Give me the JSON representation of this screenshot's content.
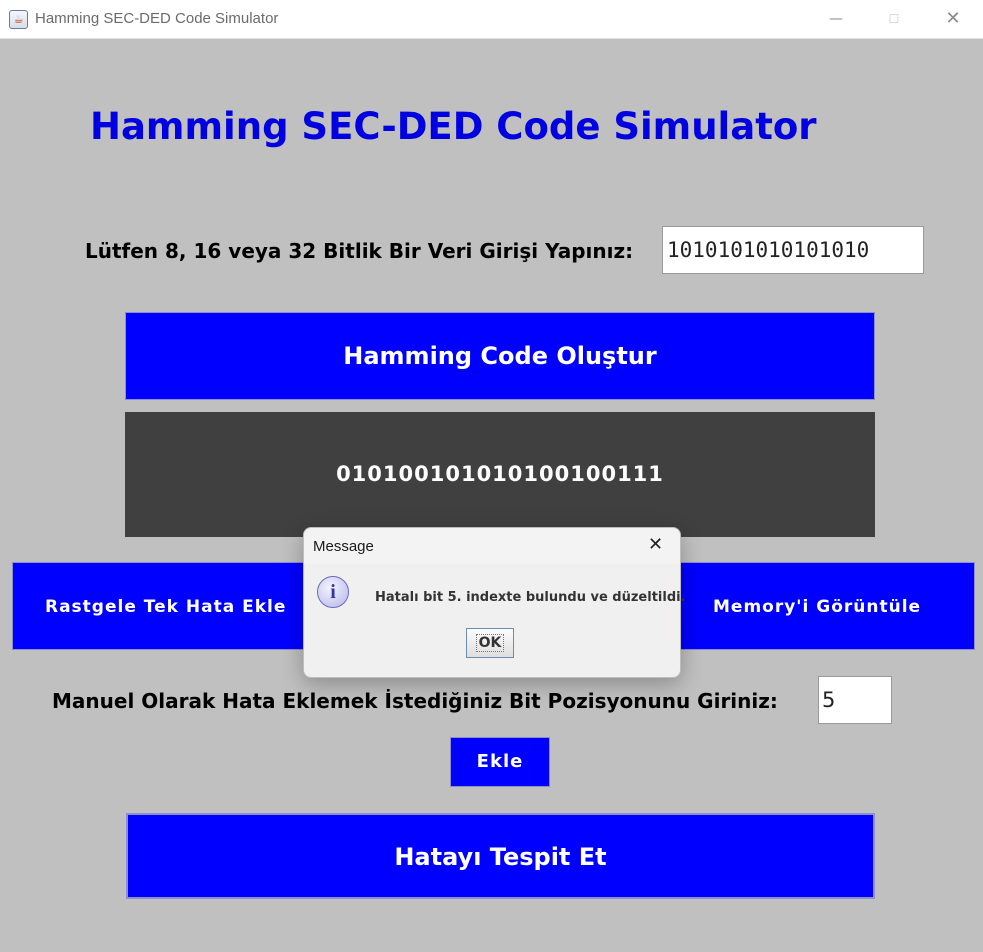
{
  "window": {
    "title": "Hamming SEC-DED Code Simulator",
    "app_icon": "java-cup-icon",
    "controls": [
      "minimize-icon",
      "maximize-icon",
      "close-icon"
    ]
  },
  "main": {
    "heading": "Hamming SEC-DED Code Simulator",
    "input_prompt": "Lütfen 8, 16 veya 32 Bitlik Bir Veri Girişi Yapınız:",
    "input_value": "1010101010101010",
    "generate_button": "Hamming Code Oluştur",
    "code_output": "010100101010100100111",
    "random_error_button": "Rastgele Tek Hata Ekle",
    "memory_button": "Memory'i Görüntüle",
    "manual_prompt": "Manuel Olarak Hata Eklemek İstediğiniz Bit Pozisyonunu Giriniz:",
    "position_value": "5",
    "add_button": "Ekle",
    "detect_button": "Hatayı Tespit Et"
  },
  "dialog": {
    "title": "Message",
    "icon": "info-icon",
    "message": "Hatalı bit 5. indexte bulundu ve düzeltildi.",
    "ok_button": "OK"
  },
  "colors": {
    "background": "#c0c0c0",
    "accent_blue": "#0000ff",
    "heading_blue": "#0000e0",
    "output_panel": "#404040"
  }
}
